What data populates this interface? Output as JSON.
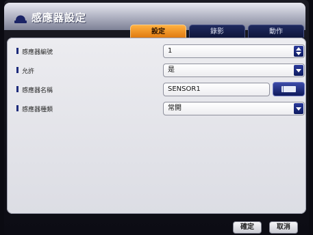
{
  "window": {
    "title": "感應器設定"
  },
  "tabs": [
    {
      "label": "設定",
      "active": true
    },
    {
      "label": "錄影",
      "active": false
    },
    {
      "label": "動作",
      "active": false
    }
  ],
  "rows": [
    {
      "label": "感應器編號",
      "value": "1",
      "control": "spinner"
    },
    {
      "label": "允許",
      "value": "是",
      "control": "dropdown"
    },
    {
      "label": "感應器名稱",
      "value": "SENSOR1",
      "control": "text-with-keyboard"
    },
    {
      "label": "感應器種類",
      "value": "常開",
      "control": "dropdown"
    }
  ],
  "footer": {
    "ok_label": "確定",
    "cancel_label": "取消"
  },
  "colors": {
    "accent_tab": "#f39a25",
    "tab_inactive": "#1a2456",
    "control_blue": "#15207a",
    "panel": "#e4e5ea"
  }
}
